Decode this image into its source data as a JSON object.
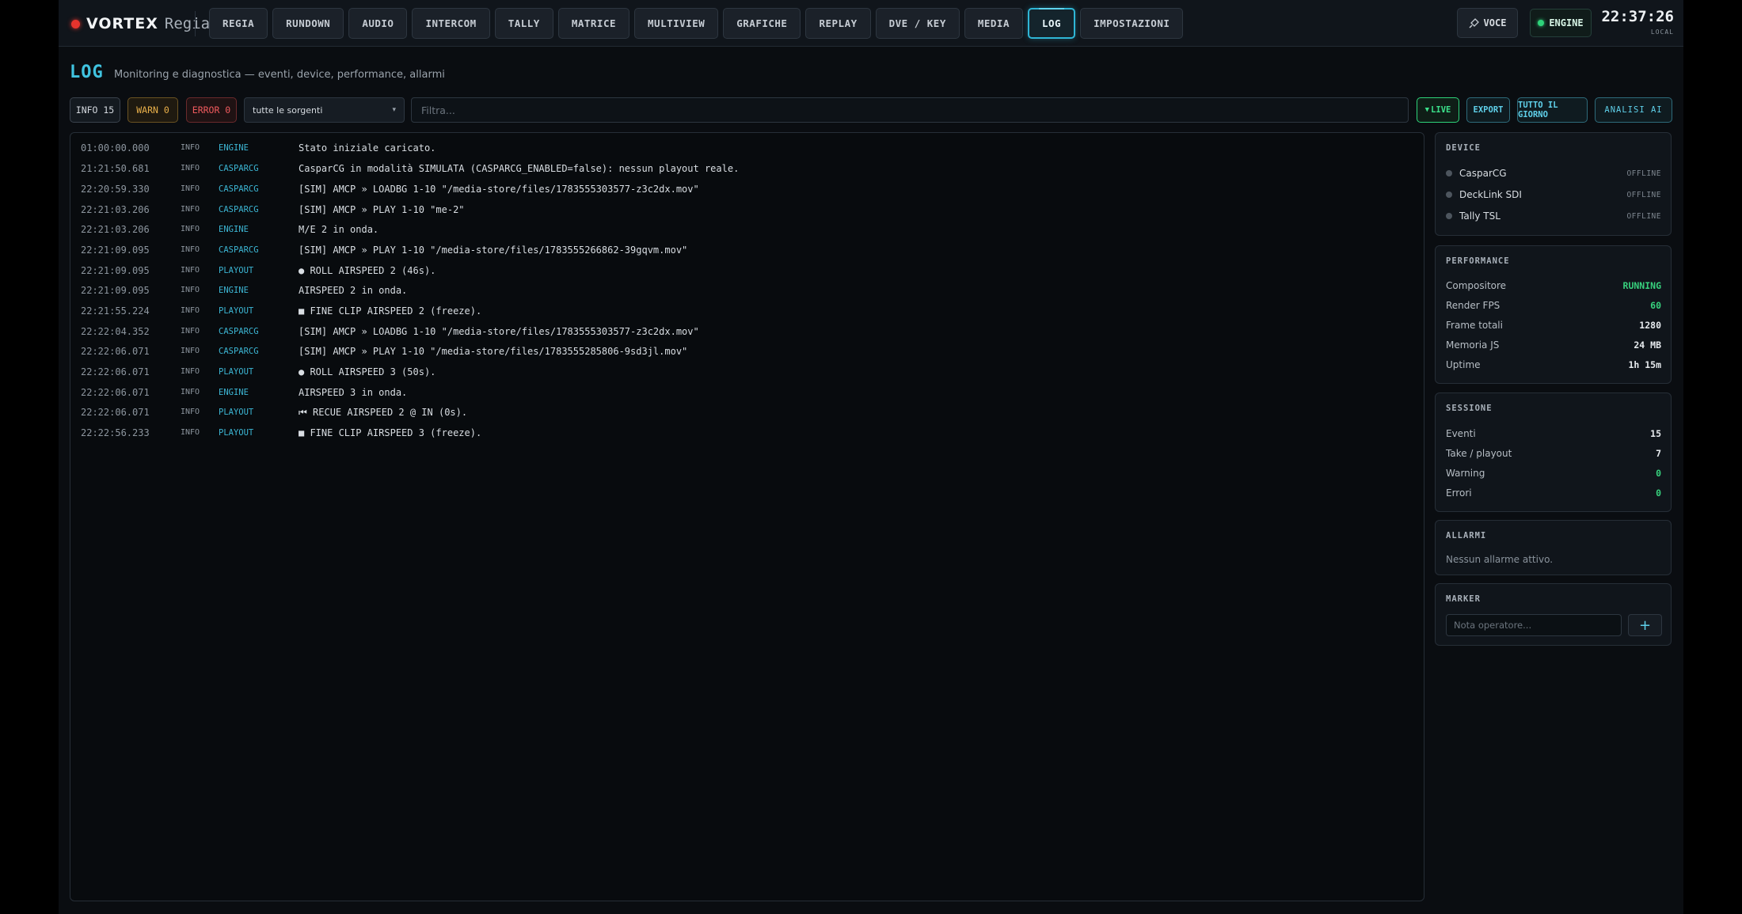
{
  "app": {
    "brand": "VORTEX",
    "brand_sub": "Regia"
  },
  "nav": {
    "tabs": [
      {
        "label": "REGIA"
      },
      {
        "label": "RUNDOWN"
      },
      {
        "label": "AUDIO"
      },
      {
        "label": "INTERCOM"
      },
      {
        "label": "TALLY"
      },
      {
        "label": "MATRICE"
      },
      {
        "label": "MULTIVIEW"
      },
      {
        "label": "GRAFICHE"
      },
      {
        "label": "REPLAY"
      },
      {
        "label": "DVE / KEY"
      },
      {
        "label": "MEDIA"
      },
      {
        "label": "LOG",
        "active": true
      },
      {
        "label": "IMPOSTAZIONI"
      }
    ],
    "voce_label": "VOCE",
    "engine_label": "ENGINE",
    "clock": "22:37:26",
    "clock_sub": "LOCAL"
  },
  "page": {
    "title": "LOG",
    "subtitle": "Monitoring e diagnostica — eventi, device, performance, allarmi"
  },
  "filters": {
    "info": "INFO 15",
    "warn": "WARN 0",
    "error": "ERROR 0",
    "source": "tutte le sorgenti",
    "search_placeholder": "Filtra...",
    "live": "LIVE",
    "export": "EXPORT",
    "all_day": "TUTTO IL GIORNO",
    "ai": "ANALISI AI"
  },
  "log": [
    {
      "ts": "01:00:00.000",
      "lvl": "INFO",
      "src": "ENGINE",
      "msg": "Stato iniziale caricato."
    },
    {
      "ts": "21:21:50.681",
      "lvl": "INFO",
      "src": "CASPARCG",
      "msg": "CasparCG in modalità SIMULATA (CASPARCG_ENABLED=false): nessun playout reale."
    },
    {
      "ts": "22:20:59.330",
      "lvl": "INFO",
      "src": "CASPARCG",
      "msg": "[SIM] AMCP » LOADBG 1-10 \"/media-store/files/1783555303577-z3c2dx.mov\""
    },
    {
      "ts": "22:21:03.206",
      "lvl": "INFO",
      "src": "CASPARCG",
      "msg": "[SIM] AMCP » PLAY 1-10 \"me-2\""
    },
    {
      "ts": "22:21:03.206",
      "lvl": "INFO",
      "src": "ENGINE",
      "msg": "M/E 2 in onda."
    },
    {
      "ts": "22:21:09.095",
      "lvl": "INFO",
      "src": "CASPARCG",
      "msg": "[SIM] AMCP » PLAY 1-10 \"/media-store/files/1783555266862-39gqvm.mov\""
    },
    {
      "ts": "22:21:09.095",
      "lvl": "INFO",
      "src": "PLAYOUT",
      "msg": "● ROLL AIRSPEED 2 (46s)."
    },
    {
      "ts": "22:21:09.095",
      "lvl": "INFO",
      "src": "ENGINE",
      "msg": "AIRSPEED 2 in onda."
    },
    {
      "ts": "22:21:55.224",
      "lvl": "INFO",
      "src": "PLAYOUT",
      "msg": "■ FINE CLIP AIRSPEED 2 (freeze)."
    },
    {
      "ts": "22:22:04.352",
      "lvl": "INFO",
      "src": "CASPARCG",
      "msg": "[SIM] AMCP » LOADBG 1-10 \"/media-store/files/1783555303577-z3c2dx.mov\""
    },
    {
      "ts": "22:22:06.071",
      "lvl": "INFO",
      "src": "CASPARCG",
      "msg": "[SIM] AMCP » PLAY 1-10 \"/media-store/files/1783555285806-9sd3jl.mov\""
    },
    {
      "ts": "22:22:06.071",
      "lvl": "INFO",
      "src": "PLAYOUT",
      "msg": "● ROLL AIRSPEED 3 (50s)."
    },
    {
      "ts": "22:22:06.071",
      "lvl": "INFO",
      "src": "ENGINE",
      "msg": "AIRSPEED 3 in onda."
    },
    {
      "ts": "22:22:06.071",
      "lvl": "INFO",
      "src": "PLAYOUT",
      "msg": "⏮ RECUE AIRSPEED 2 @ IN (0s)."
    },
    {
      "ts": "22:22:56.233",
      "lvl": "INFO",
      "src": "PLAYOUT",
      "msg": "■ FINE CLIP AIRSPEED 3 (freeze)."
    }
  ],
  "device": {
    "title": "DEVICE",
    "items": [
      {
        "name": "CasparCG",
        "status": "OFFLINE"
      },
      {
        "name": "DeckLink SDI",
        "status": "OFFLINE"
      },
      {
        "name": "Tally TSL",
        "status": "OFFLINE"
      }
    ]
  },
  "performance": {
    "title": "PERFORMANCE",
    "items": [
      {
        "key": "Compositore",
        "val": "RUNNING",
        "green": true
      },
      {
        "key": "Render FPS",
        "val": "60",
        "green": true
      },
      {
        "key": "Frame totali",
        "val": "1280"
      },
      {
        "key": "Memoria JS",
        "val": "24 MB"
      },
      {
        "key": "Uptime",
        "val": "1h 15m"
      }
    ]
  },
  "sessione": {
    "title": "SESSIONE",
    "items": [
      {
        "key": "Eventi",
        "val": "15"
      },
      {
        "key": "Take / playout",
        "val": "7"
      },
      {
        "key": "Warning",
        "val": "0",
        "green": true
      },
      {
        "key": "Errori",
        "val": "0",
        "green": true
      }
    ]
  },
  "allarmi": {
    "title": "ALLARMI",
    "empty": "Nessun allarme attivo."
  },
  "marker": {
    "title": "MARKER",
    "placeholder": "Nota operatore...",
    "add": "+"
  },
  "colors": {
    "accent": "#40c3e0",
    "live": "#2ed37a",
    "warn": "#e9b04a",
    "error": "#ef5a5d",
    "brand_dot": "#e5342d"
  }
}
